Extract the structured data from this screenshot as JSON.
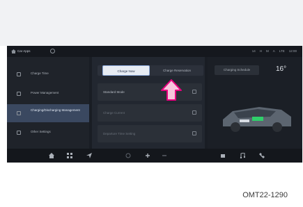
{
  "status_bar": {
    "title": "Car Apps",
    "icons": [
      "home-icon",
      "gear-icon"
    ],
    "right_items": [
      "14",
      "H",
      "M",
      "A",
      "LTE",
      "12:00"
    ]
  },
  "sidebar": {
    "items": [
      {
        "label": "Charge Time",
        "icon": "charge-icon",
        "active": false
      },
      {
        "label": "Power Management",
        "icon": "power-icon",
        "active": false
      },
      {
        "label": "Charging/Discharging Management",
        "icon": "plug-icon",
        "active": true
      },
      {
        "label": "Other Settings",
        "icon": "settings-icon",
        "active": false
      }
    ]
  },
  "main": {
    "tabs": [
      {
        "label": "Charge Now",
        "selected": true
      },
      {
        "label": "Charge Reservation",
        "selected": false
      }
    ],
    "rows": [
      {
        "label": "Standard Mode",
        "dim": false
      },
      {
        "label": "Charge Current",
        "dim": true
      },
      {
        "label": "Departure Time Setting",
        "dim": true
      }
    ]
  },
  "right_panel": {
    "button_label": "Charging Schedule",
    "temperature": "16",
    "temperature_unit": "°"
  },
  "dock": {
    "icons": [
      "home-icon",
      "apps-icon",
      "navigation-icon",
      "fan-icon",
      "climate-icon",
      "fan-speed-icon",
      "seat-icon",
      "music-icon",
      "phone-icon"
    ]
  },
  "caption": "OMT22-1290",
  "colors": {
    "accent": "#e6007e",
    "screen_bg": "#191d24"
  }
}
